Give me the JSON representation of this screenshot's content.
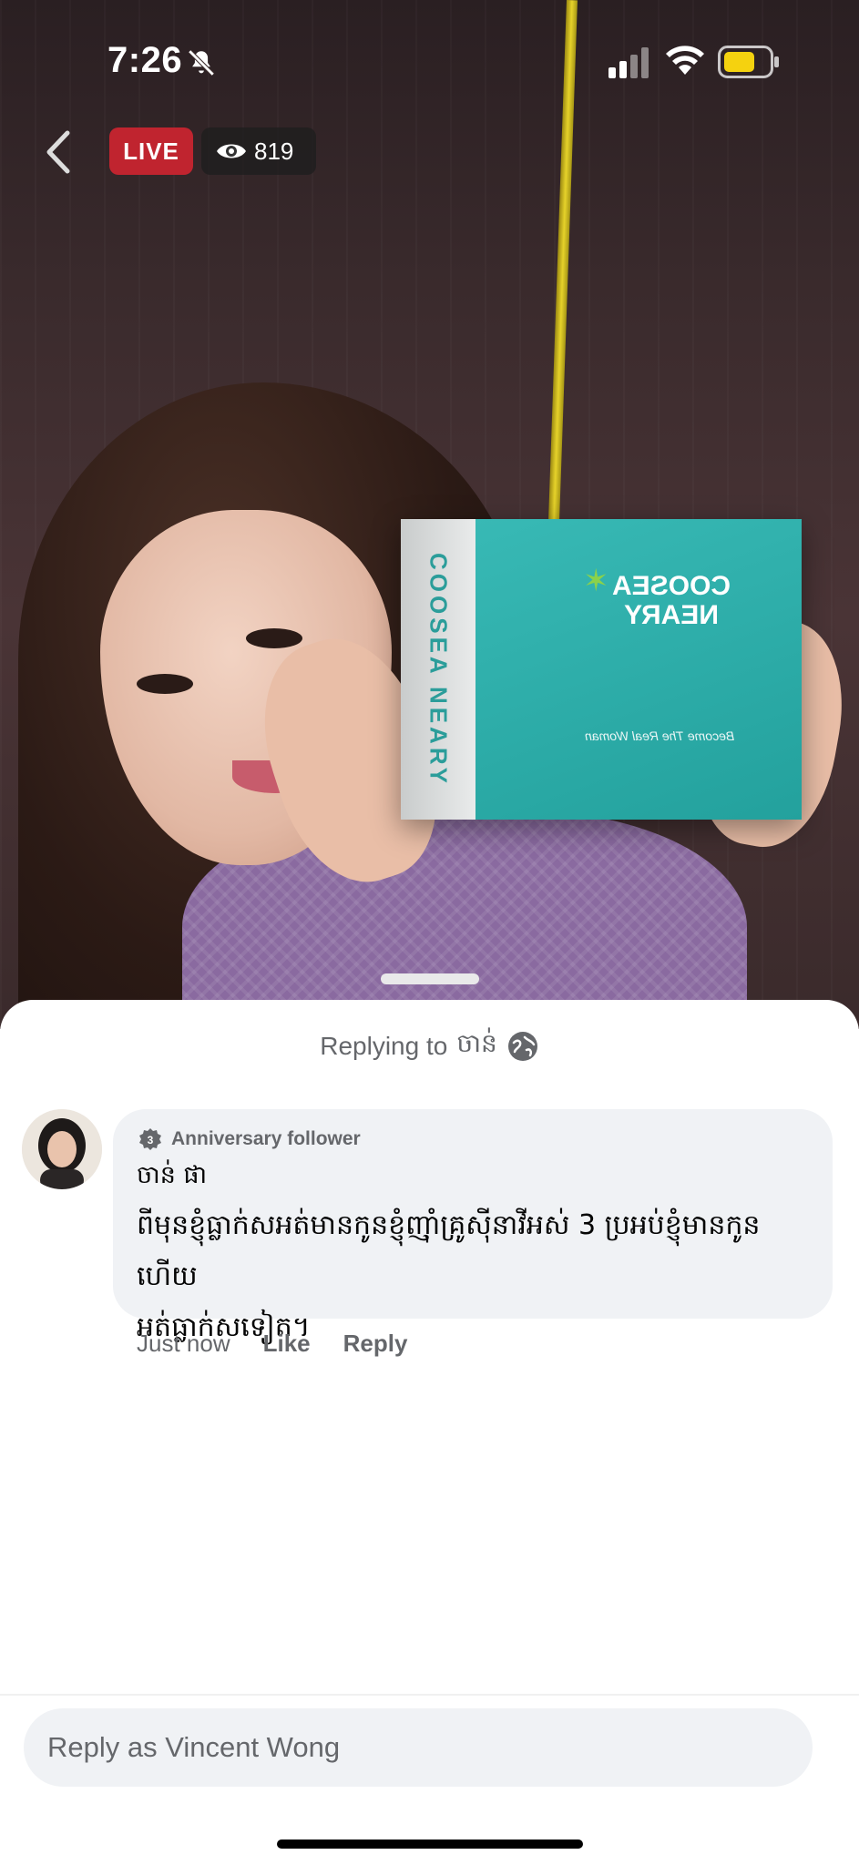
{
  "status_bar": {
    "time": "7:26",
    "icons": [
      "bell-muted-icon",
      "signal-icon",
      "wifi-icon",
      "battery-icon"
    ],
    "battery_color": "#f5d20f"
  },
  "live": {
    "badge": "LIVE",
    "viewer_count": "819",
    "badge_color": "#c0242f"
  },
  "video": {
    "product_side_text": "COOSEA NEARY",
    "product_brand_line1": "COOSEA",
    "product_brand_line2": "NEARY",
    "product_tagline": "Become The Real Woman"
  },
  "sheet": {
    "replying_to_prefix": "Replying to",
    "replying_to_name": "ចាន់"
  },
  "comment": {
    "badge_number": "3",
    "badge_label": "Anniversary follower",
    "author": "ចាន់ ផា",
    "text_line1": "ពីមុនខ្ញុំធ្លាក់សអត់មានកូនខ្ញុំញ៉ាំគ្រូស៊ីនាវីអស់ 3 ប្រអប់ខ្ញុំមានកូនហើយ",
    "text_line2": "អត់ធ្លាក់សទៀត។",
    "time": "Just now",
    "like_label": "Like",
    "reply_label": "Reply"
  },
  "composer": {
    "placeholder": "Reply as Vincent Wong"
  }
}
